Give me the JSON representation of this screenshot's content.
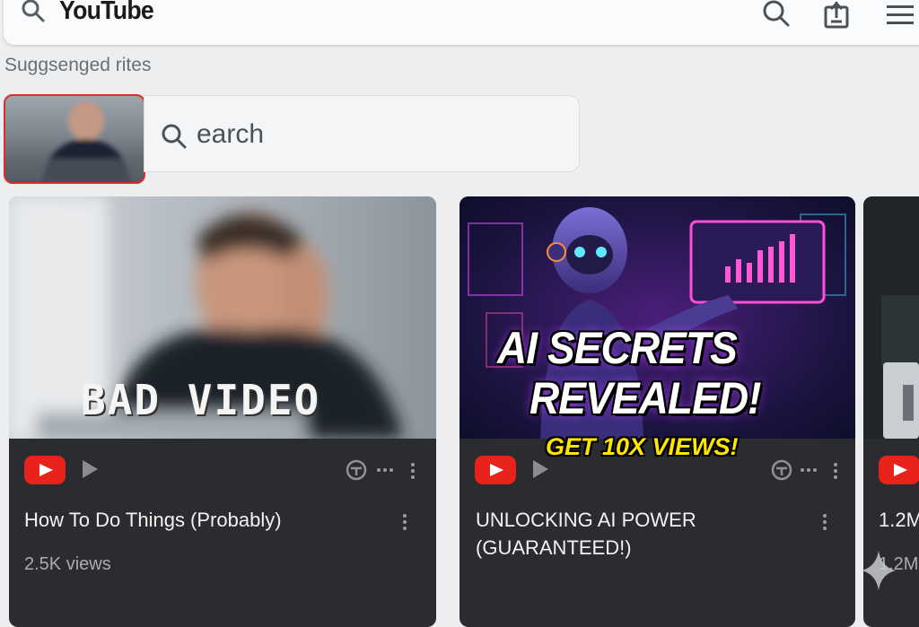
{
  "header": {
    "logo_text": "YouTube",
    "icons": [
      "search-icon",
      "upload-icon",
      "menu-icon"
    ]
  },
  "section": {
    "label": "Suggsenged rites"
  },
  "search": {
    "value": "earch"
  },
  "cards": [
    {
      "thumbnail_text": "BAD VIDEO",
      "title": "How To Do Things (Probably)",
      "views": "2.5K views"
    },
    {
      "thumbnail_line1": "AI SECRETS",
      "thumbnail_line2": "REVEALED!",
      "thumbnail_line3": "GET 10X VIEWS!",
      "title_line1": "UNLOCKING AI POWER",
      "title_line2": "(GUARANTEED!)"
    },
    {
      "title": "1.2M",
      "views": "1.2M"
    }
  ],
  "colors": {
    "accent": "#e8231c",
    "card_bg": "#2b2c2f",
    "highlight_yellow": "#ffe600",
    "neon_purple": "#b13cff"
  }
}
